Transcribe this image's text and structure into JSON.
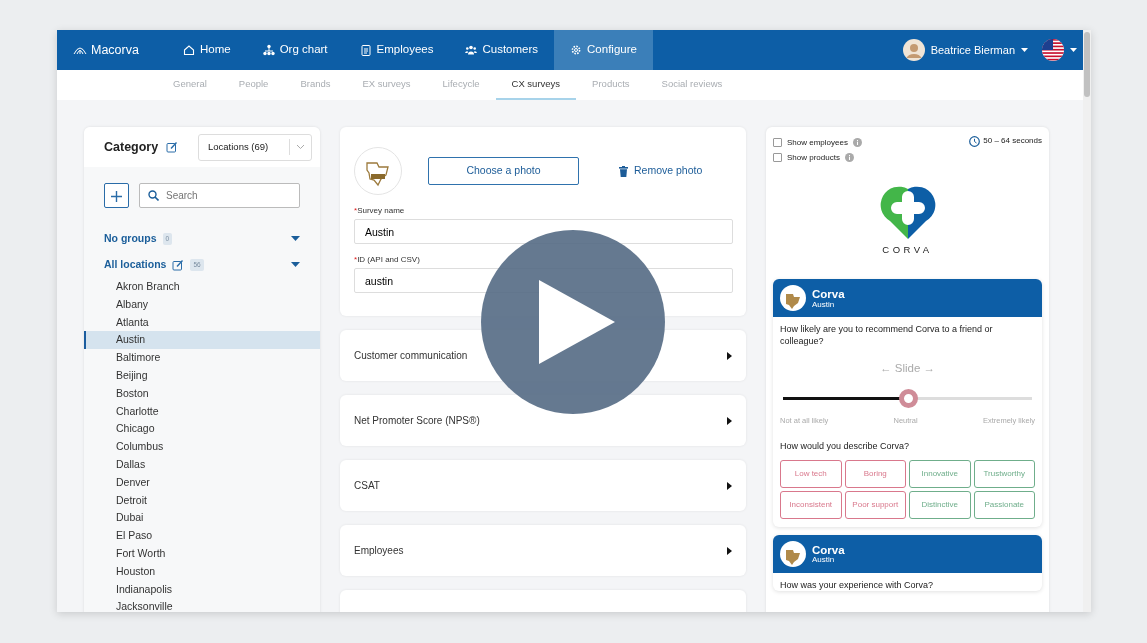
{
  "nav": {
    "brand": "Macorva",
    "items": [
      {
        "label": "Home",
        "selected": false
      },
      {
        "label": "Org chart",
        "selected": false
      },
      {
        "label": "Employees",
        "selected": false
      },
      {
        "label": "Customers",
        "selected": false
      },
      {
        "label": "Configure",
        "selected": true
      }
    ],
    "user": "Beatrice Bierman"
  },
  "subnav": [
    {
      "label": "General",
      "selected": false
    },
    {
      "label": "People",
      "selected": false
    },
    {
      "label": "Brands",
      "selected": false
    },
    {
      "label": "EX surveys",
      "selected": false
    },
    {
      "label": "Lifecycle",
      "selected": false
    },
    {
      "label": "CX surveys",
      "selected": true
    },
    {
      "label": "Products",
      "selected": false
    },
    {
      "label": "Social reviews",
      "selected": false
    }
  ],
  "category": {
    "title": "Category",
    "select": "Locations (69)",
    "search_placeholder": "Search",
    "groups": [
      {
        "label": "No groups",
        "count": "0",
        "editable": false
      },
      {
        "label": "All locations",
        "count": "56",
        "editable": true,
        "children": [
          {
            "label": "Akron Branch",
            "selected": false
          },
          {
            "label": "Albany",
            "selected": false
          },
          {
            "label": "Atlanta",
            "selected": false
          },
          {
            "label": "Austin",
            "selected": true
          },
          {
            "label": "Baltimore",
            "selected": false
          },
          {
            "label": "Beijing",
            "selected": false
          },
          {
            "label": "Boston",
            "selected": false
          },
          {
            "label": "Charlotte",
            "selected": false
          },
          {
            "label": "Chicago",
            "selected": false
          },
          {
            "label": "Columbus",
            "selected": false
          },
          {
            "label": "Dallas",
            "selected": false
          },
          {
            "label": "Denver",
            "selected": false
          },
          {
            "label": "Detroit",
            "selected": false
          },
          {
            "label": "Dubai",
            "selected": false
          },
          {
            "label": "El Paso",
            "selected": false
          },
          {
            "label": "Fort Worth",
            "selected": false
          },
          {
            "label": "Houston",
            "selected": false
          },
          {
            "label": "Indianapolis",
            "selected": false
          },
          {
            "label": "Jacksonville",
            "selected": false
          }
        ]
      }
    ]
  },
  "survey_form": {
    "choose_photo": "Choose a photo",
    "remove_photo": "Remove photo",
    "fields": [
      {
        "mark": "*",
        "label": "Survey name",
        "value": "Austin"
      },
      {
        "mark": "*",
        "label": "ID (API and CSV)",
        "value": "austin"
      }
    ],
    "sections": [
      {
        "title": "Customer communication"
      },
      {
        "title": "Net Promoter Score (NPS®)"
      },
      {
        "title": "CSAT"
      },
      {
        "title": "Employees"
      }
    ]
  },
  "preview": {
    "options": [
      {
        "label": "Show employees",
        "checked": false
      },
      {
        "label": "Show products",
        "checked": false
      }
    ],
    "duration": "50 – 64 seconds",
    "brand_name": "CORVA",
    "cards": [
      {
        "title": "Corva",
        "subtitle": "Austin",
        "question": "How likely are you to recommend Corva to a friend or colleague?",
        "slider": {
          "label": "← Slide →",
          "level": 0.5,
          "labels": [
            "Not at all likely",
            "Neutral",
            "Extremely likely"
          ]
        },
        "question2": "How would you describe Corva?",
        "tags": [
          {
            "label": "Low tech",
            "color": "#d9788c"
          },
          {
            "label": "Boring",
            "color": "#d9788c"
          },
          {
            "label": "Innovative",
            "color": "#6fae8b"
          },
          {
            "label": "Trustworthy",
            "color": "#6fae8b"
          },
          {
            "label": "Inconsistent",
            "color": "#d9788c"
          },
          {
            "label": "Poor support",
            "color": "#d9788c"
          },
          {
            "label": "Distinctive",
            "color": "#6fae8b"
          },
          {
            "label": "Passionate",
            "color": "#6fae8b"
          }
        ]
      },
      {
        "title": "Corva",
        "subtitle": "Austin",
        "question": "How was your experience with Corva?"
      }
    ]
  }
}
